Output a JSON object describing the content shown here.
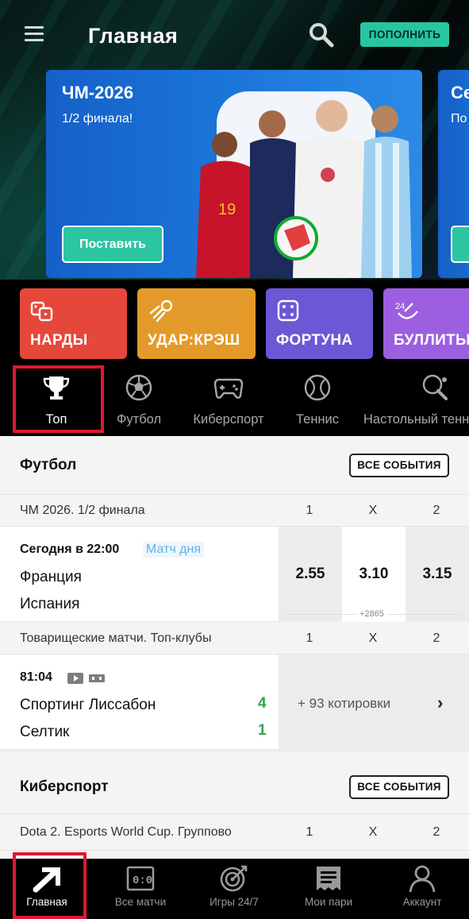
{
  "header": {
    "title": "Главная",
    "topup_label": "ПОПОЛНИТЬ"
  },
  "banner": {
    "title": "ЧМ-2026",
    "subtitle": "1/2 финала!",
    "button_label": "Поставить",
    "next_title": "Се",
    "next_subtitle": "По"
  },
  "game_tiles": [
    {
      "label": "НАРДЫ",
      "color": "#e5483a",
      "icon": "dice-pair-icon"
    },
    {
      "label": "УДАР:КРЭШ",
      "color": "#e39a2a",
      "icon": "rocket-ball-icon"
    },
    {
      "label": "ФОРТУНА",
      "color": "#6a58d6",
      "icon": "dice-icon"
    },
    {
      "label": "БУЛЛИТЫ",
      "color": "#9b5fe0",
      "icon": "puck-24-icon"
    }
  ],
  "sports_tabs": [
    {
      "label": "Топ",
      "icon": "trophy-icon",
      "active": true
    },
    {
      "label": "Футбол",
      "icon": "soccer-ball-icon"
    },
    {
      "label": "Киберспорт",
      "icon": "gamepad-icon"
    },
    {
      "label": "Теннис",
      "icon": "tennis-ball-icon"
    },
    {
      "label": "Настольный теннис",
      "icon": "table-tennis-icon"
    }
  ],
  "sections": [
    {
      "title": "Футбол",
      "all_events_label": "ВСЕ СОБЫТИЯ",
      "leagues": [
        {
          "name": "ЧМ 2026. 1/2 финала",
          "headers": [
            "1",
            "X",
            "2"
          ],
          "match": {
            "time": "Сегодня в 22:00",
            "tag": "Матч дня",
            "team1": "Франция",
            "team2": "Испания",
            "odds": [
              "2.55",
              "3.10",
              "3.15"
            ],
            "more": "+2865"
          }
        },
        {
          "name": "Товарищеские матчи. Топ-клубы",
          "headers": [
            "1",
            "X",
            "2"
          ],
          "match": {
            "time": "81:04",
            "team1": "Спортинг Лиссабон",
            "team2": "Селтик",
            "score1": "4",
            "score2": "1",
            "quotes": "+ 93 котировки"
          }
        }
      ]
    },
    {
      "title": "Киберспорт",
      "all_events_label": "ВСЕ СОБЫТИЯ",
      "leagues": [
        {
          "name": "Dota 2. Esports World Cup. Группово",
          "headers": [
            "1",
            "X",
            "2"
          ]
        }
      ]
    }
  ],
  "bottom_nav": [
    {
      "label": "Главная",
      "icon": "arrow-logo-icon",
      "active": true
    },
    {
      "label": "Все матчи",
      "icon": "scoreboard-icon"
    },
    {
      "label": "Игры 24/7",
      "icon": "target-dart-icon"
    },
    {
      "label": "Мои пари",
      "icon": "coupon-icon"
    },
    {
      "label": "Аккаунт",
      "icon": "user-icon"
    }
  ],
  "colors": {
    "accent": "#27c6a2",
    "highlight_box": "#e0172e",
    "score_green": "#2aa84a",
    "tag_blue": "#5fb2e6"
  }
}
